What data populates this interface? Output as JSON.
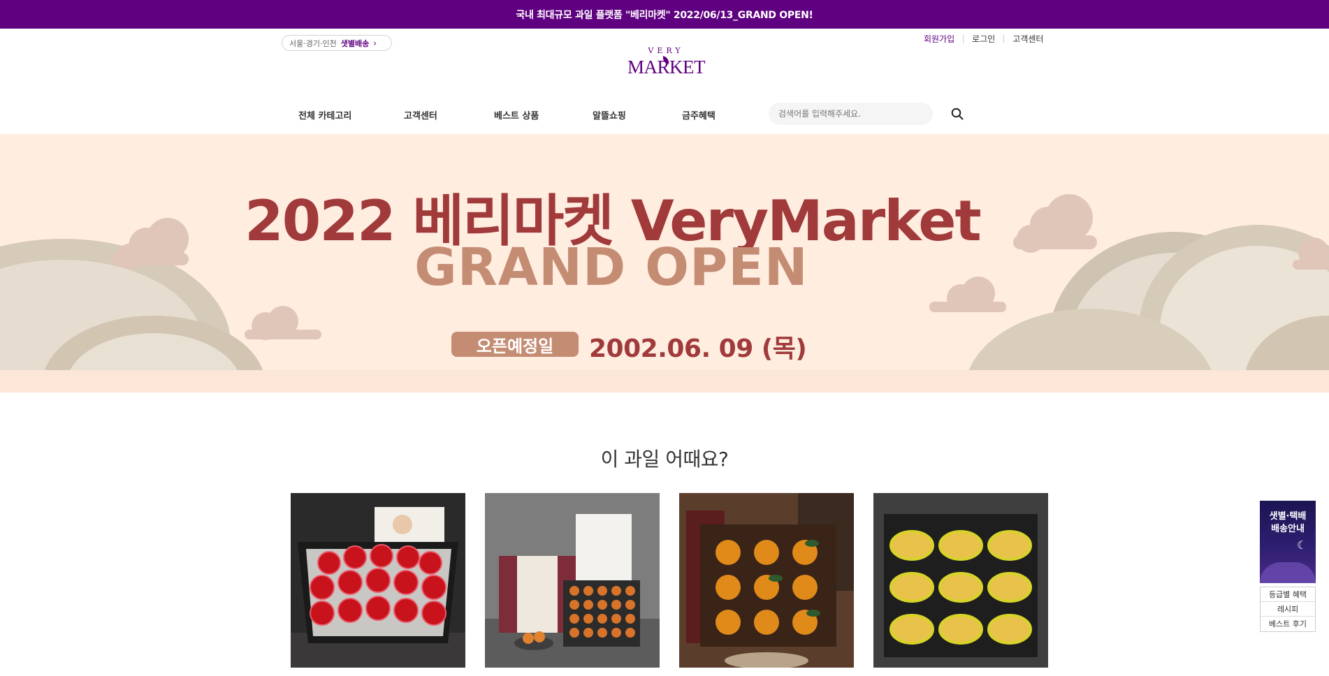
{
  "topbar": {
    "announcement": "국내 최대규모 과일 플랫폼 \"베리마켓\" 2022/06/13_GRAND OPEN!"
  },
  "header": {
    "delivery": {
      "area": "서울·경기·인천",
      "type": "샛별배송",
      "chevron": "›"
    },
    "user_menu": {
      "join": "회원가입",
      "login": "로그인",
      "support": "고객센터"
    },
    "logo": {
      "top": "VERY",
      "main": "MARKET"
    }
  },
  "nav": {
    "items": [
      {
        "label": "전체 카테고리"
      },
      {
        "label": "고객센터"
      },
      {
        "label": "베스트 상품"
      },
      {
        "label": "알뜰쇼핑"
      },
      {
        "label": "금주혜택"
      }
    ],
    "search_placeholder": "검색어를 입력해주세요."
  },
  "banner": {
    "title": "2022 베리마켓 VeryMarket",
    "subtitle": "GRAND OPEN",
    "badge": "오픈예정일",
    "date": "2002.06. 09 (목)"
  },
  "section": {
    "title": "이 과일 어때요?"
  },
  "products": [
    {
      "icon": "apple-gift-box-image"
    },
    {
      "icon": "dried-persimmon-gift-set-image"
    },
    {
      "icon": "persimmon-gift-box-image"
    },
    {
      "icon": "mango-gift-box-image"
    }
  ],
  "side": {
    "banner_line1": "샛별·택배",
    "banner_line2": "배송안내",
    "links": [
      "등급별 혜택",
      "레시피",
      "베스트 후기"
    ]
  },
  "colors": {
    "brand": "#5f0080",
    "banner_title": "#a13a3a",
    "banner_sub": "#c58c74",
    "banner_bg": "#ffede0"
  }
}
